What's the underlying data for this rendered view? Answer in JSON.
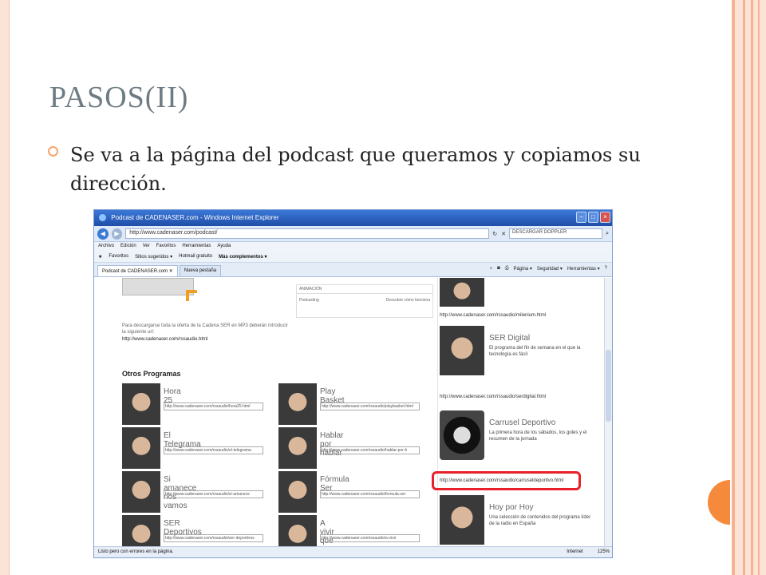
{
  "slide": {
    "title": "PASOS(II)",
    "bullet_text": "Se va a la página del podcast que queramos y copiamos su dirección."
  },
  "browser": {
    "window_title": "Podcast de CADENASER.com - Windows Internet Explorer",
    "address": "http://www.cadenaser.com/podcast/",
    "search_placeholder": "DESCARGAR DOPPLER",
    "menu": [
      "Archivo",
      "Edición",
      "Ver",
      "Favoritos",
      "Herramientas",
      "Ayuda"
    ],
    "favorites": [
      "Favoritos",
      "Sitios sugeridos ▾",
      "Hotmail gratuito",
      "Más complementos ▾"
    ],
    "tabs": [
      "Podcast de CADENASER.com",
      "Nueva pestaña"
    ],
    "command_bar": [
      "Página ▾",
      "Seguridad ▾",
      "Herramientas ▾"
    ],
    "status_left": "Listo pero con errores en la página.",
    "status_zone": "Internet",
    "status_zoom": "125%"
  },
  "page": {
    "animacion_header": "ANIMACIÓN",
    "animacion_row_left": "Podcasting",
    "animacion_row_right": "Descubre cómo funciona",
    "promo_text": "Para descargarse toda la oferta de la Cadena SER en MP3 deberán introducir la siguiente url:",
    "promo_url": "http://www.cadenaser.com/rssaudio.html",
    "otros_title": "Otros Programas",
    "programs": [
      {
        "name": "Hora 25",
        "url": "http://www.cadenaser.com/rssaudio/hora25.html"
      },
      {
        "name": "Play Basket",
        "url": "http://www.cadenaser.com/rssaudio/playbasket.html"
      },
      {
        "name": "El Telegrama",
        "url": "http://www.cadenaser.com/rssaudio/el-telegrama"
      },
      {
        "name": "Hablar por hablar",
        "url": "http://www.cadenaser.com/rssaudio/hablar-por-h"
      },
      {
        "name": "Si amanece nos vamos",
        "url": "http://www.cadenaser.com/rssaudio/si-amanece"
      },
      {
        "name": "Fórmula Ser",
        "url": "http://www.cadenaser.com/rssaudio/formula-ser"
      },
      {
        "name": "SER Deportivos",
        "url": "http://www.cadenaser.com/rssaudio/ser-deportivos"
      },
      {
        "name": "A vivir que son dos dias",
        "url": "http://www.cadenaser.com/rssaudio/a-vivir"
      }
    ],
    "right_items": [
      {
        "url": "http://www.cadenaser.com/rssaudio/milenium.html"
      },
      {
        "title": "SER Digital",
        "desc": "El programa del fin de semana en el que la tecnología es fácil",
        "url": "http://www.cadenaser.com/rssaudio/serdigital.html"
      },
      {
        "title": "Carrusel Deportivo",
        "desc": "La primera hora de los sábados, los goles y el resumen de la jornada",
        "url": "http://www.cadenaser.com/rssaudio/carruseldeportivo.html"
      },
      {
        "title": "Hoy por Hoy",
        "desc": "Una selección de contenidos del programa líder de la radio en España"
      }
    ]
  },
  "colors": {
    "accent_orange": "#f58a3c",
    "frame_peach": "#fbe3d6",
    "highlight_red": "#e8202a"
  }
}
